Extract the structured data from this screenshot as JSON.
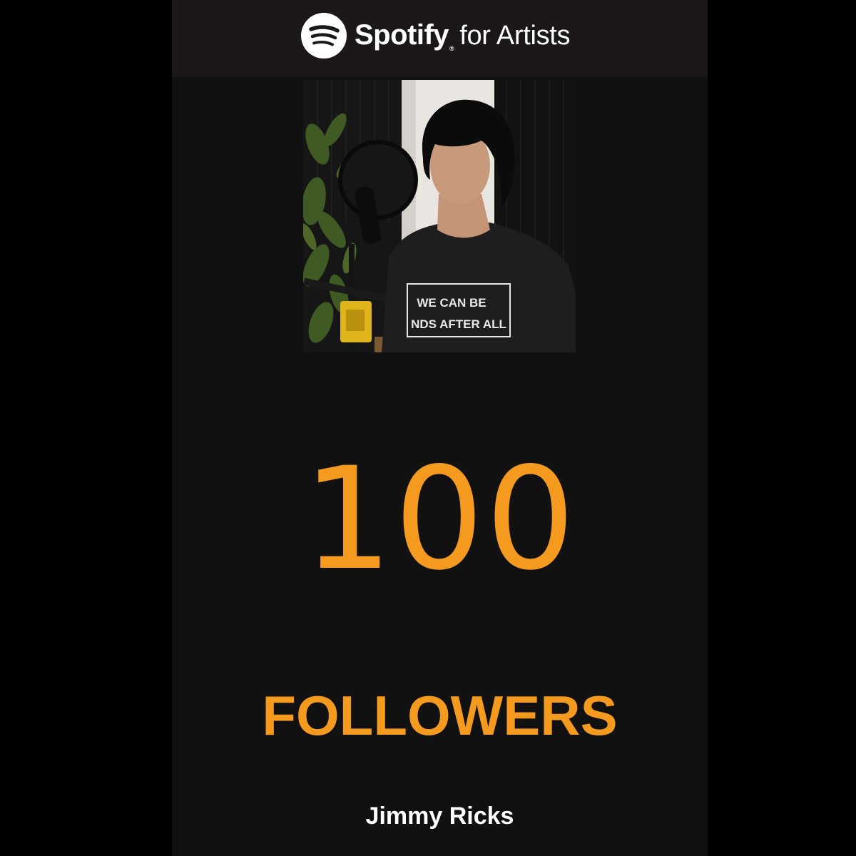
{
  "header": {
    "logo_icon": "spotify-logo-icon",
    "brand_name": "Spotify",
    "brand_registered_mark": "®",
    "brand_suffix": "for Artists"
  },
  "artist_photo": {
    "shirt_text_line1": "WE CAN BE",
    "shirt_text_line2": "NDS AFTER ALL"
  },
  "milestone": {
    "count": "100",
    "label": "FOLLOWERS"
  },
  "artist": {
    "name": "Jimmy Ricks"
  },
  "colors": {
    "accent": "#f39a1f",
    "background": "#111111",
    "header_background": "#1c1818",
    "page_background": "#000000",
    "text": "#ffffff"
  }
}
